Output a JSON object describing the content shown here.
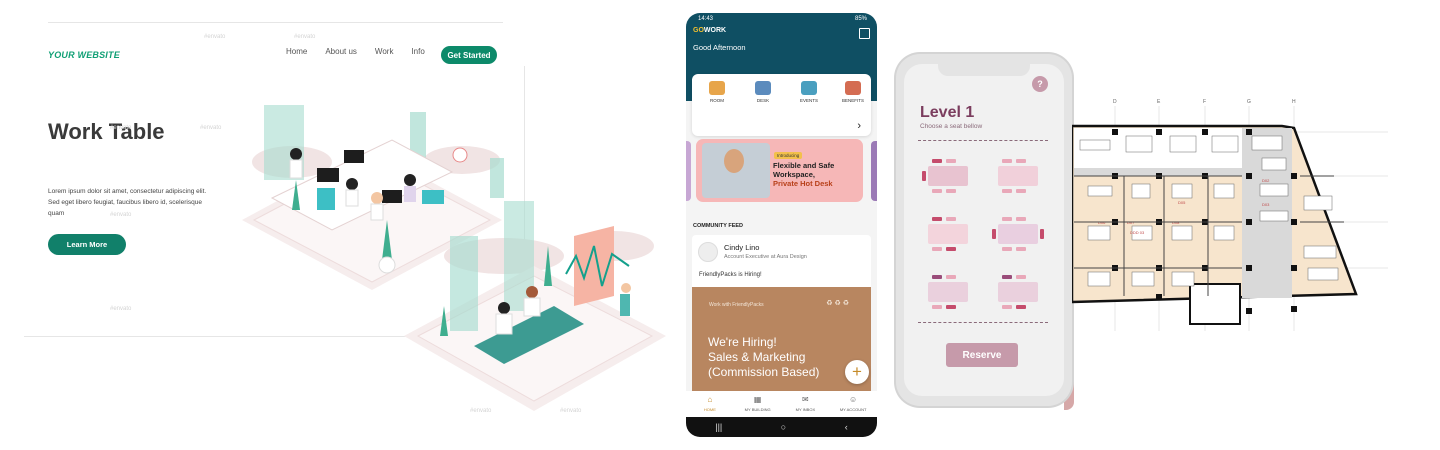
{
  "landing": {
    "brand": "YOUR WEBSITE",
    "nav": [
      "Home",
      "About us",
      "Work",
      "Info"
    ],
    "cta": "Get Started",
    "hero_title": "Work Table",
    "hero_text": "Lorem ipsum dolor sit amet, consectetur adipiscing elit. Sed eget libero feugiat, faucibus libero id, scelerisque quam",
    "learn_more": "Learn More",
    "watermark": "#envato"
  },
  "app_phone": {
    "time": "14:43",
    "battery": "85%",
    "logo_go": "GO",
    "logo_work": "WORK",
    "greeting": "Good Afternoon",
    "categories": [
      {
        "label": "ROOM",
        "icon": "chair-icon",
        "color": "#e7a54a"
      },
      {
        "label": "DESK",
        "icon": "desk-icon",
        "color": "#5b8bbd"
      },
      {
        "label": "EVENTS",
        "icon": "events-icon",
        "color": "#4a9fbf"
      },
      {
        "label": "BENEFITS",
        "icon": "benefits-icon",
        "color": "#d46c52"
      }
    ],
    "banner": {
      "tag": "Introducing",
      "title": "Flexible and Safe Workspace,",
      "subtitle": "Private Hot Desk"
    },
    "feed_label": "COMMUNITY FEED",
    "post": {
      "name": "Cindy Lino",
      "role": "Account Executive at Aura Design",
      "text": "FriendlyPacks is Hiring!",
      "image_header": "Work with FriendlyPacks",
      "image_line1": "We're Hiring!",
      "image_line2": "Sales & Marketing",
      "image_line3": "(Commission Based)"
    },
    "tabs": [
      {
        "label": "HOME",
        "icon": "home-icon",
        "active": true
      },
      {
        "label": "MY BUILDING",
        "icon": "building-icon",
        "active": false
      },
      {
        "label": "MY INBOX",
        "icon": "inbox-icon",
        "active": false
      },
      {
        "label": "MY ACCOUNT",
        "icon": "account-icon",
        "active": false
      }
    ]
  },
  "seat_phone": {
    "help": "?",
    "title": "Level 1",
    "subtitle": "Choose a seat bellow",
    "reserve": "Reserve"
  },
  "floor_plan": {
    "columns": [
      "D",
      "E",
      "F",
      "G",
      "H"
    ],
    "rooms": [
      "D06",
      "D07",
      "D08",
      "D02",
      "D03",
      "D05",
      "DDD 03"
    ]
  }
}
